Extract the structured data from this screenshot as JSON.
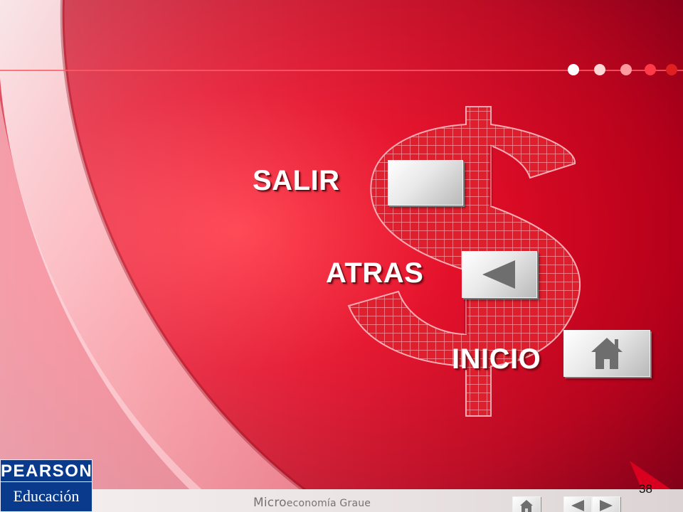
{
  "slide": {
    "nav_buttons": {
      "salir_label": "SALIR",
      "atras_label": "ATRAS",
      "inicio_label": "INICIO"
    },
    "decorative": {
      "dollar_sign_icon": "dollar-sign-icon",
      "dots_colors": [
        "#ffffff",
        "#ffd6d6",
        "#ff9aa0",
        "#ff3a48",
        "#e02020"
      ]
    },
    "footer": {
      "publisher_line1": "PEARSON",
      "publisher_line2": "Educación",
      "title_prefix": "Micro",
      "title_rest": "economía Graue",
      "page_number": "38"
    },
    "colors": {
      "background": "#c8001a",
      "logo_blue": "#0a3a8c"
    }
  }
}
